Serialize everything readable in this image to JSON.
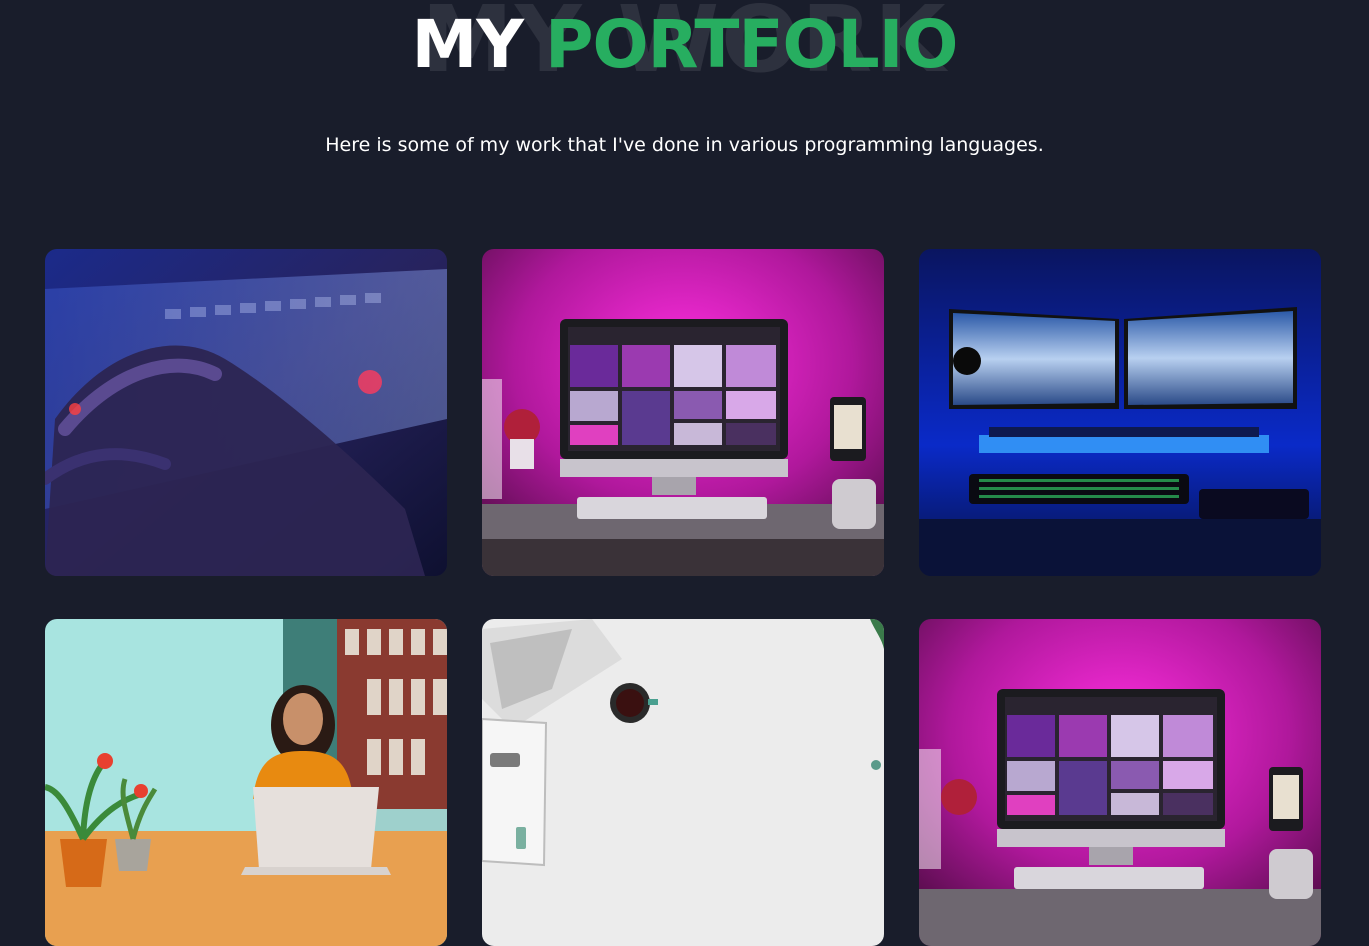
{
  "header": {
    "background_word": "MY WORK",
    "title_white": "MY",
    "title_green": "PORTFOLIO",
    "subtitle": "Here is some of my work that I've done in various programming languages."
  },
  "colors": {
    "background": "#191d2b",
    "accent": "#27ae60"
  },
  "portfolio": {
    "items": [
      {
        "image": "hand-on-backlit-keyboard"
      },
      {
        "image": "pink-lit-imac-desk"
      },
      {
        "image": "dual-monitor-blue-setup"
      },
      {
        "image": "woman-with-laptop"
      },
      {
        "image": "white-desk-flatlay"
      },
      {
        "image": "pink-lit-imac-desk-2"
      }
    ]
  }
}
